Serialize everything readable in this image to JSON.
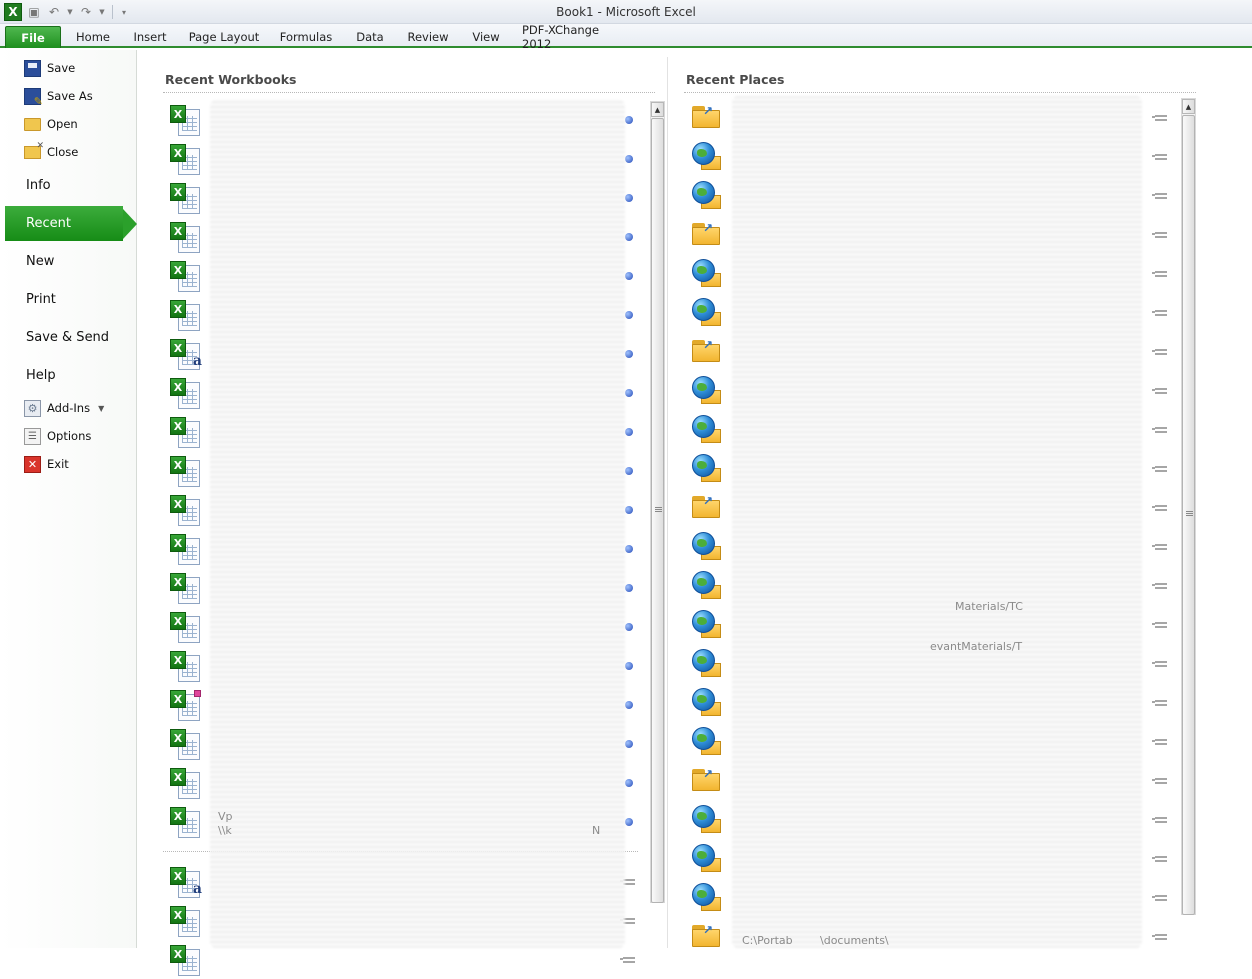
{
  "window": {
    "title": "Book1  -  Microsoft Excel"
  },
  "quick_access": {
    "logo": "X"
  },
  "tabs": [
    {
      "label": "File"
    },
    {
      "label": "Home"
    },
    {
      "label": "Insert"
    },
    {
      "label": "Page Layout"
    },
    {
      "label": "Formulas"
    },
    {
      "label": "Data"
    },
    {
      "label": "Review"
    },
    {
      "label": "View"
    },
    {
      "label": "PDF-XChange 2012"
    }
  ],
  "backstage": {
    "small_items": [
      {
        "label": "Save",
        "icon": "save-icon"
      },
      {
        "label": "Save As",
        "icon": "save-as-icon"
      },
      {
        "label": "Open",
        "icon": "open-folder-icon"
      },
      {
        "label": "Close",
        "icon": "close-folder-icon"
      }
    ],
    "big_items": [
      {
        "label": "Info"
      },
      {
        "label": "Recent",
        "selected": true
      },
      {
        "label": "New"
      },
      {
        "label": "Print"
      },
      {
        "label": "Save & Send"
      },
      {
        "label": "Help"
      }
    ],
    "bottom_items": [
      {
        "label": "Add-Ins",
        "icon": "add-ins-icon",
        "has_dropdown": true
      },
      {
        "label": "Options",
        "icon": "options-icon"
      },
      {
        "label": "Exit",
        "icon": "exit-icon"
      }
    ]
  },
  "recent_workbooks": {
    "title": "Recent Workbooks",
    "visible_text_fragments": [
      "Vp",
      "\\\\k",
      "N"
    ]
  },
  "recent_places": {
    "title": "Recent Places",
    "visible_text_fragments": [
      "Materials/TC",
      "evantMaterials/T",
      "C:\\Portab",
      "\\documents\\"
    ]
  },
  "theme": {
    "accent": "#2f8c2f",
    "file_tab": "#1f8f1f",
    "pinned": "#2449b6"
  }
}
